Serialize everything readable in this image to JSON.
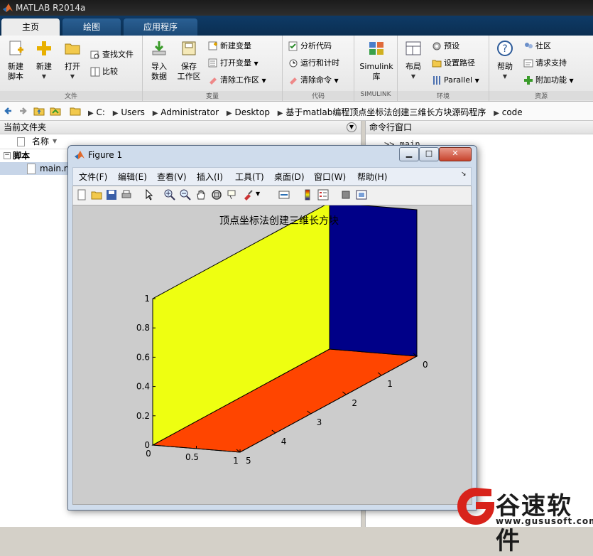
{
  "window": {
    "title": "MATLAB R2014a"
  },
  "tabs": [
    {
      "label": "主页",
      "active": true
    },
    {
      "label": "绘图",
      "active": false
    },
    {
      "label": "应用程序",
      "active": false
    }
  ],
  "ribbon": {
    "file": {
      "caption": "文件",
      "new_script": "新建\n脚本",
      "new": "新建",
      "open": "打开",
      "find_files": "查找文件",
      "compare": "比较"
    },
    "variable": {
      "caption": "变量",
      "import": "导入\n数据",
      "save_workspace": "保存\n工作区",
      "new_variable": "新建变量",
      "open_variable": "打开变量",
      "clear_workspace": "清除工作区"
    },
    "code": {
      "caption": "代码",
      "analyze": "分析代码",
      "run_time": "运行和计时",
      "clear_commands": "清除命令"
    },
    "simulink": {
      "caption": "SIMULINK",
      "library": "Simulink\n库"
    },
    "environment": {
      "caption": "环境",
      "layout": "布局",
      "preferences": "预设",
      "set_path": "设置路径",
      "parallel": "Parallel"
    },
    "resources": {
      "caption": "资源",
      "help": "帮助",
      "community": "社区",
      "support": "请求支持",
      "addons": "附加功能"
    }
  },
  "path": [
    "C:",
    "Users",
    "Administrator",
    "Desktop",
    "基于matlab编程顶点坐标法创建三维长方块源码程序",
    "code"
  ],
  "current_folder": {
    "title": "当前文件夹",
    "col_name": "名称",
    "group": "脚本",
    "files": [
      "main.m"
    ]
  },
  "command_window": {
    "title": "命令行窗口",
    "prompt": ">> main"
  },
  "figure": {
    "title": "Figure 1",
    "menu": [
      "文件(F)",
      "编辑(E)",
      "查看(V)",
      "插入(I)",
      "工具(T)",
      "桌面(D)",
      "窗口(W)",
      "帮助(H)"
    ],
    "toolbar_icons": [
      "new-figure-icon",
      "open-icon",
      "save-icon",
      "print-icon",
      "select-arrow-icon",
      "zoom-in-icon",
      "zoom-out-icon",
      "pan-hand-icon",
      "rotate-3d-icon",
      "data-cursor-icon",
      "brush-icon",
      "link-icon",
      "colorbar-icon",
      "legend-icon",
      "hide-tools-icon",
      "show-tools-icon"
    ]
  },
  "chart_data": {
    "type": "3d-patch",
    "title": "顶点坐标法创建三维长方块",
    "x_ticks": [
      "0",
      "0.5",
      "1"
    ],
    "y_ticks": [
      "0",
      "1",
      "2",
      "3",
      "4",
      "5"
    ],
    "z_ticks": [
      "0",
      "0.2",
      "0.4",
      "0.6",
      "0.8",
      "1"
    ],
    "xlim": [
      0,
      1
    ],
    "ylim": [
      0,
      5
    ],
    "zlim": [
      0,
      1
    ],
    "faces": [
      {
        "name": "bottom",
        "plane": "z=0",
        "color": "#ff4500"
      },
      {
        "name": "side-x0",
        "plane": "x=0",
        "color": "#eeff11"
      },
      {
        "name": "end-y0",
        "plane": "y=0",
        "color": "#000088"
      }
    ]
  },
  "watermark": {
    "brand": "谷速软件",
    "url": "www.gususoft.com"
  },
  "colors": {
    "ribbon_blue": "#0e3a66",
    "surface_yellow": "#eeff11",
    "surface_orange": "#ff4500",
    "surface_navy": "#000088"
  }
}
